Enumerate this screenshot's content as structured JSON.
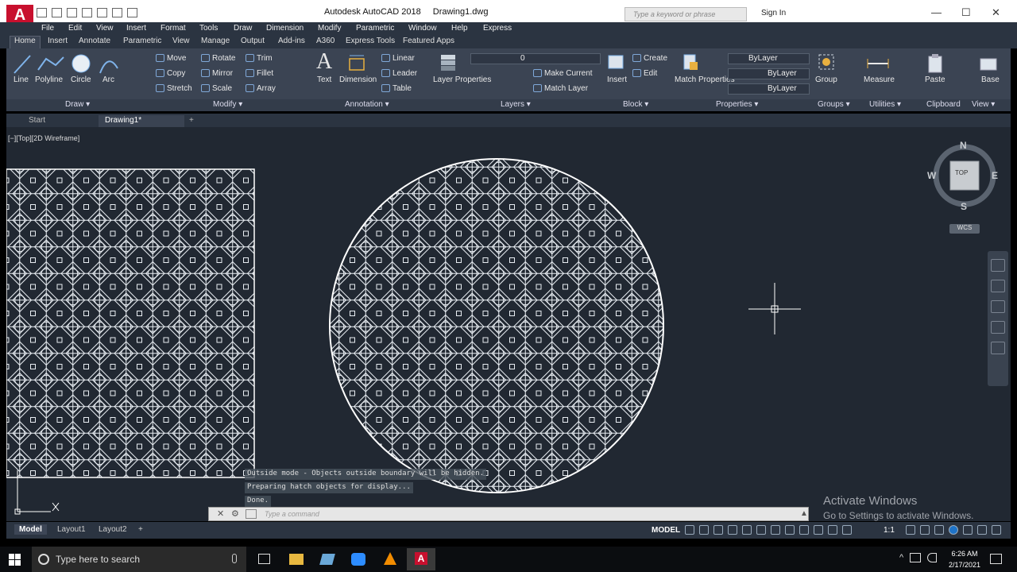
{
  "window": {
    "app_title": "Autodesk AutoCAD 2018",
    "doc_title": "Drawing1.dwg",
    "search_placeholder": "Type a keyword or phrase",
    "sign_in": "Sign In"
  },
  "menus": [
    "File",
    "Edit",
    "View",
    "Insert",
    "Format",
    "Tools",
    "Draw",
    "Dimension",
    "Modify",
    "Parametric",
    "Window",
    "Help",
    "Express"
  ],
  "ribbon_tabs": [
    "Home",
    "Insert",
    "Annotate",
    "Parametric",
    "View",
    "Manage",
    "Output",
    "Add-ins",
    "A360",
    "Express Tools",
    "Featured Apps"
  ],
  "draw": {
    "line": "Line",
    "polyline": "Polyline",
    "circle": "Circle",
    "arc": "Arc",
    "panel": "Draw ▾"
  },
  "modify": {
    "move": "Move",
    "rotate": "Rotate",
    "trim": "Trim",
    "copy": "Copy",
    "mirror": "Mirror",
    "fillet": "Fillet",
    "stretch": "Stretch",
    "scale": "Scale",
    "array": "Array",
    "panel": "Modify ▾"
  },
  "annotation": {
    "text": "Text",
    "dimension": "Dimension",
    "linear": "Linear",
    "leader": "Leader",
    "table": "Table",
    "panel": "Annotation ▾"
  },
  "layers": {
    "layer_properties": "Layer Properties",
    "layer_value": "0",
    "make_current": "Make Current",
    "match_layer": "Match Layer",
    "panel": "Layers ▾"
  },
  "block": {
    "insert": "Insert",
    "create": "Create",
    "edit": "Edit",
    "panel": "Block ▾"
  },
  "properties": {
    "match": "Match Properties",
    "color": "ByLayer",
    "linetype": "ByLayer",
    "lineweight": "ByLayer",
    "panel": "Properties ▾"
  },
  "groups": {
    "group": "Group",
    "panel": "Groups ▾"
  },
  "utilities": {
    "measure": "Measure",
    "panel": "Utilities ▾"
  },
  "clipboard": {
    "paste": "Paste",
    "panel": "Clipboard"
  },
  "viewpanel": {
    "base": "Base",
    "panel": "View ▾"
  },
  "doc_tabs": {
    "start": "Start",
    "drawing": "Drawing1*"
  },
  "viewport": {
    "label": "[−][Top][2D Wireframe]",
    "compass_n": "N",
    "compass_s": "S",
    "compass_e": "E",
    "compass_w": "W",
    "cube_face": "TOP",
    "wcs": "WCS"
  },
  "command": {
    "history": [
      "Outside mode - Objects outside boundary will be hidden.",
      "Preparing hatch objects for display...",
      "Done."
    ],
    "placeholder": "Type a command"
  },
  "layout_tabs": [
    "Model",
    "Layout1",
    "Layout2"
  ],
  "status": {
    "mode": "MODEL",
    "scale": "1:1"
  },
  "watermark": {
    "title": "Activate Windows",
    "subtitle": "Go to Settings to activate Windows."
  },
  "taskbar": {
    "search": "Type here to search",
    "time": "6:26 AM",
    "date": "2/17/2021"
  }
}
